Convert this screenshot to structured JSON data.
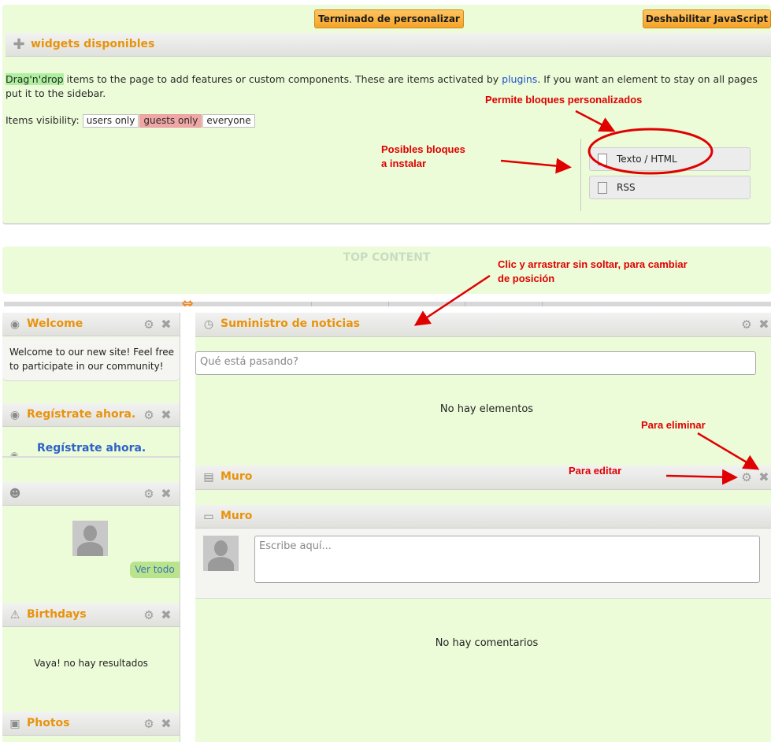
{
  "toolbar": {
    "finish_label": "Terminado de personalizar",
    "disable_js_label": "Deshabilitar JavaScript"
  },
  "widgets_panel": {
    "title": "widgets disponibles",
    "intro_highlight": "Drag'n'drop",
    "intro_text_1": " items to the page to add features or custom components. These are items activated by ",
    "plugins_link": "plugins",
    "intro_text_2": ". If you want an element to stay on all pages put it to the sidebar.",
    "visibility_label": "Items visibility:",
    "visibility_options": [
      "users only",
      "guests only",
      "everyone"
    ],
    "available_widgets": [
      "Texto / HTML",
      "RSS"
    ]
  },
  "annotations": {
    "custom_blocks": "Permite bloques personalizados",
    "installable_line1": "Posibles bloques",
    "installable_line2": "a instalar",
    "drag_line1": "Clic y arrastrar sin soltar, para cambiar",
    "drag_line2": "de posición",
    "delete": "Para eliminar",
    "edit": "Para editar"
  },
  "top_content": {
    "label": "TOP CONTENT"
  },
  "sidebar": {
    "welcome": {
      "title": "Welcome",
      "text": "Welcome to our new site! Feel free to participate in our community!"
    },
    "register": {
      "title": "Regístrate ahora.",
      "link": "Regístrate ahora."
    },
    "members": {
      "view_all": "Ver todo"
    },
    "birthdays": {
      "title": "Birthdays",
      "empty": "Vaya! no hay resultados"
    },
    "photos": {
      "title": "Photos"
    }
  },
  "main": {
    "feed": {
      "title": "Suministro de noticias",
      "placeholder": "Qué está pasando?",
      "empty": "No hay elementos"
    },
    "wall_bar": {
      "title": "Muro"
    },
    "wall": {
      "title": "Muro",
      "placeholder": "Escribe aquí...",
      "empty": "No hay comentarios"
    }
  },
  "colors": {
    "panel_green": "#ecfcd8",
    "title_orange": "#e8930c",
    "annotation_red": "#e00000",
    "button_orange": "#f5a428"
  }
}
